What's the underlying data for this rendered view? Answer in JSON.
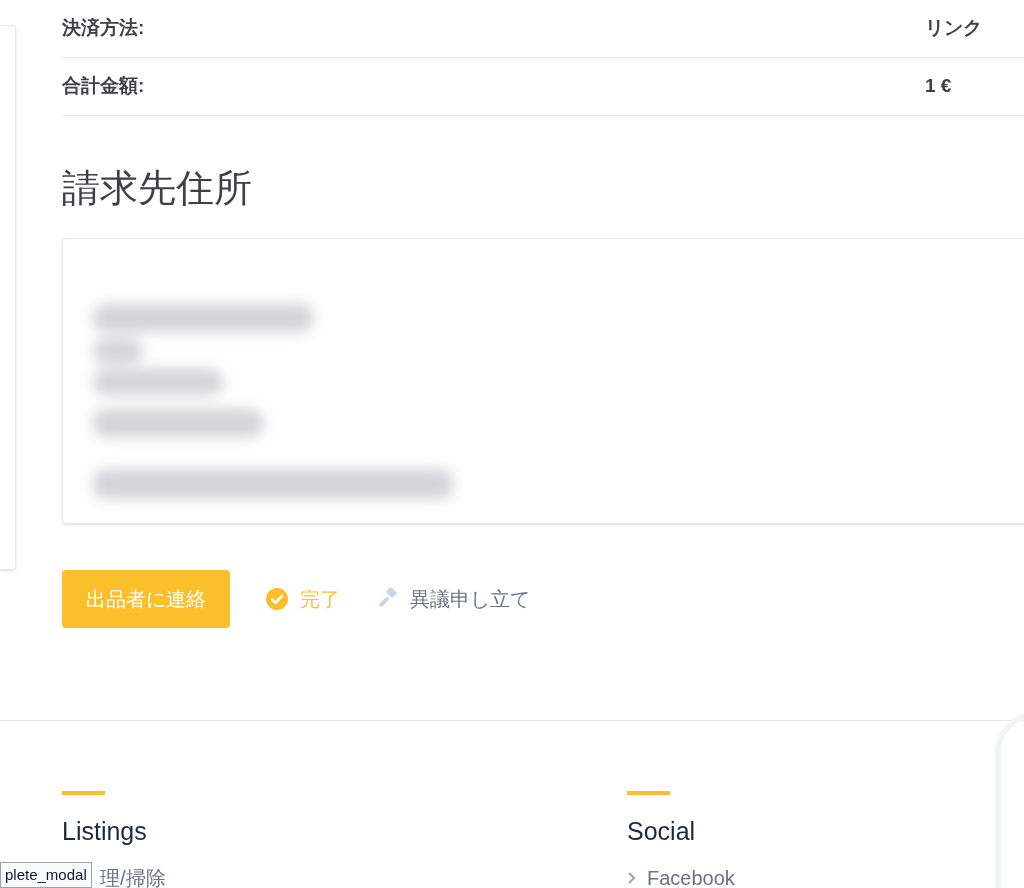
{
  "summary": [
    {
      "label": "決済方法:",
      "value": "リンク"
    },
    {
      "label": "合計金額:",
      "value": "1 €"
    }
  ],
  "billing": {
    "title": "請求先住所"
  },
  "actions": {
    "contact_button": "出品者に連絡",
    "status": {
      "label": "完了",
      "done": true
    },
    "dispute": "異議申し立て"
  },
  "footer": {
    "columns": [
      {
        "title": "Listings",
        "items": [
          "理/掃除"
        ],
        "chevrons": false
      },
      {
        "title": "Social",
        "items": [
          "Facebook"
        ],
        "chevrons": true
      }
    ]
  },
  "tooltip": "plete_modal"
}
